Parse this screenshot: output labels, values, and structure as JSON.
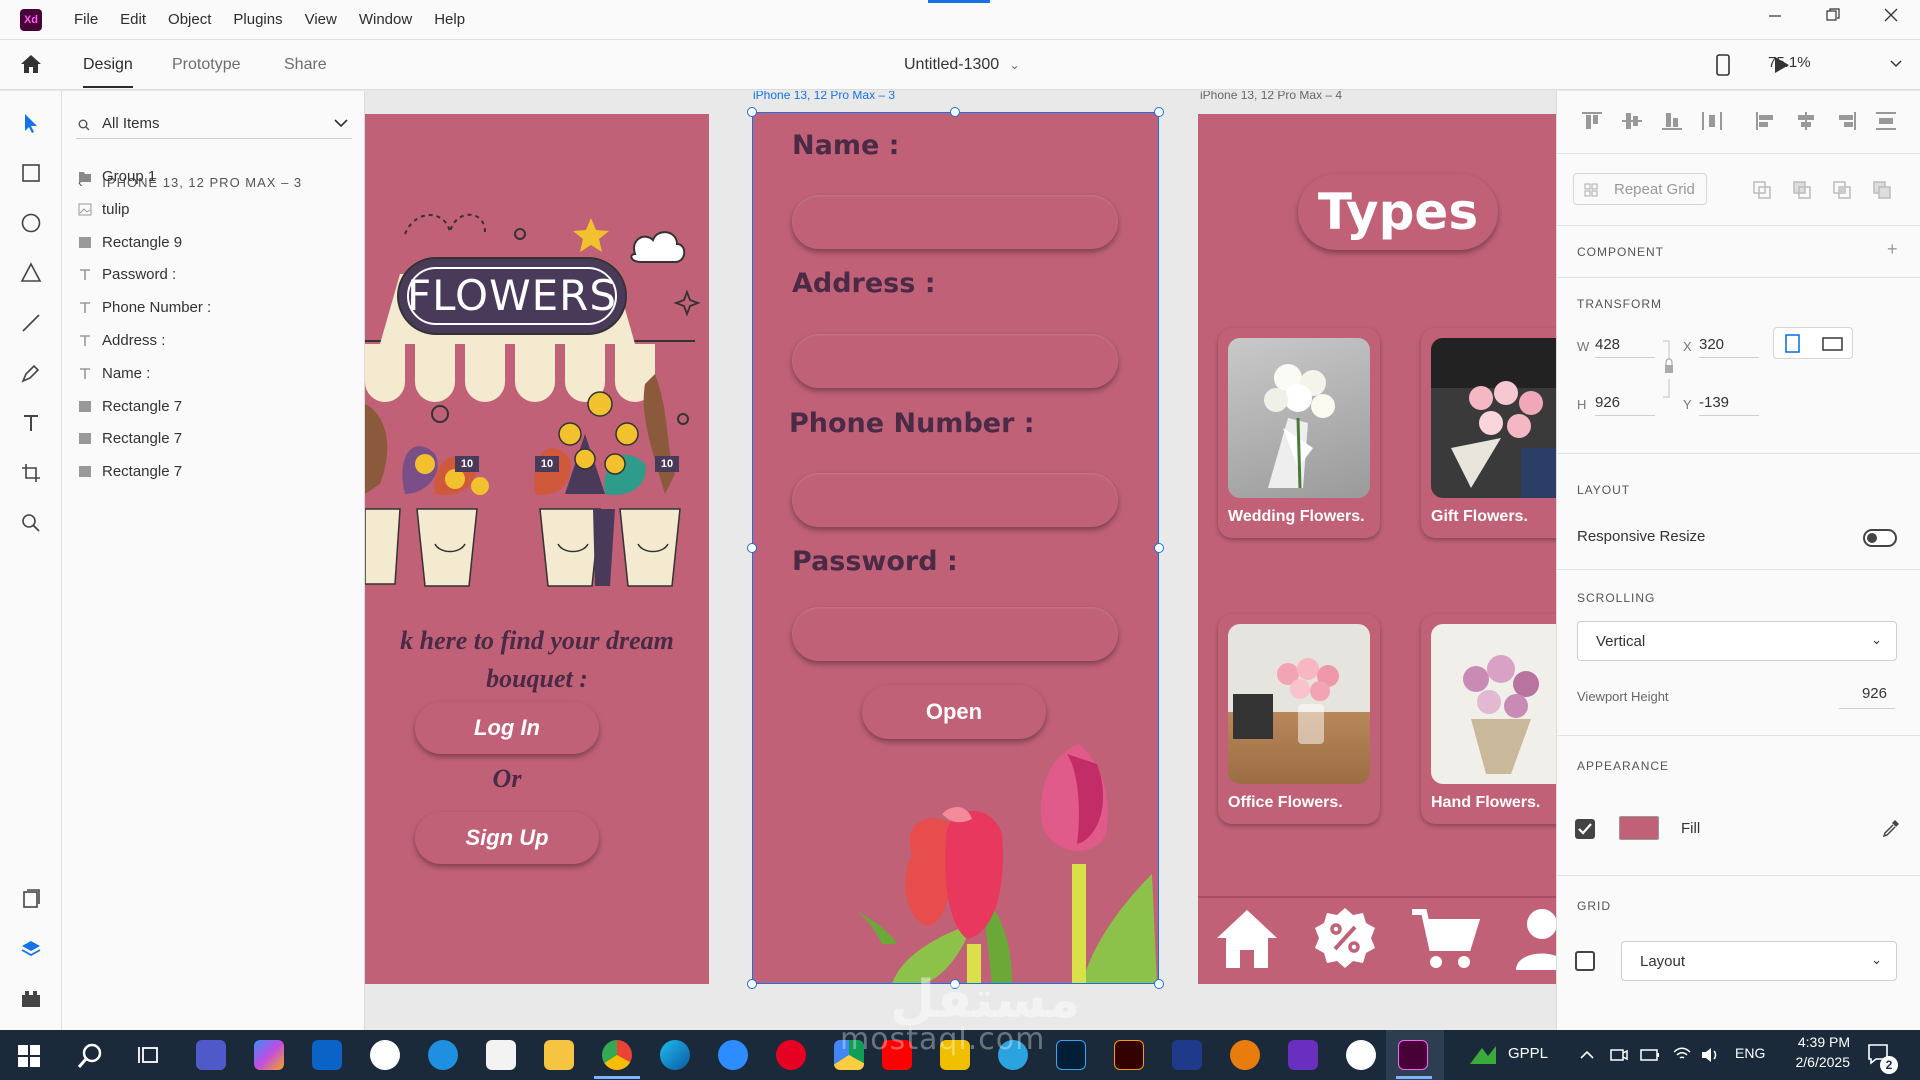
{
  "app": {
    "logo": "Xd",
    "menu": [
      "File",
      "Edit",
      "Object",
      "Plugins",
      "View",
      "Window",
      "Help"
    ],
    "tabs": [
      "Design",
      "Prototype",
      "Share"
    ],
    "document_title": "Untitled-1300",
    "zoom": "75.1%"
  },
  "layers": {
    "search_label": "All Items",
    "breadcrumb": "IPHONE 13, 12 PRO MAX – 3",
    "items": [
      {
        "name": "Group 1",
        "icon": "folder-icon"
      },
      {
        "name": "tulip",
        "icon": "image-icon"
      },
      {
        "name": "Rectangle 9",
        "icon": "rectangle-icon"
      },
      {
        "name": "Password :",
        "icon": "text-icon"
      },
      {
        "name": "Phone Number :",
        "icon": "text-icon"
      },
      {
        "name": "Address :",
        "icon": "text-icon"
      },
      {
        "name": "Name :",
        "icon": "text-icon"
      },
      {
        "name": "Rectangle 7",
        "icon": "rectangle-icon"
      },
      {
        "name": "Rectangle 7",
        "icon": "rectangle-icon"
      },
      {
        "name": "Rectangle 7",
        "icon": "rectangle-icon"
      }
    ]
  },
  "artboards": {
    "left": {
      "sign_text": "FLOWERS",
      "tag_numbers": [
        "10",
        "10",
        "10"
      ],
      "tagline": "k here to find your dream bouquet :",
      "login_button": "Log In",
      "or_text": "Or",
      "signup_button": "Sign Up"
    },
    "middle": {
      "label": "iPhone 13, 12 Pro Max – 3",
      "fields": [
        "Name :",
        "Address :",
        "Phone Number :",
        "Password :"
      ],
      "open_button": "Open"
    },
    "right": {
      "label": "iPhone 13, 12 Pro Max – 4",
      "title": "Types",
      "cards": [
        "Wedding Flowers.",
        "Gift Flowers.",
        "Office Flowers.",
        "Hand Flowers."
      ],
      "nav_icons": [
        "home-icon",
        "discount-icon",
        "cart-icon",
        "profile-icon"
      ]
    }
  },
  "inspector": {
    "repeat_grid": "Repeat Grid",
    "component_title": "COMPONENT",
    "transform_title": "TRANSFORM",
    "w_label": "W",
    "w_value": "428",
    "h_label": "H",
    "h_value": "926",
    "x_label": "X",
    "x_value": "320",
    "y_label": "Y",
    "y_value": "-139",
    "layout_title": "LAYOUT",
    "responsive_resize": "Responsive Resize",
    "scrolling_title": "SCROLLING",
    "scrolling_value": "Vertical",
    "viewport_label": "Viewport Height",
    "viewport_value": "926",
    "appearance_title": "APPEARANCE",
    "fill_label": "Fill",
    "fill_color": "#c06178",
    "fill_checked": true,
    "grid_title": "GRID",
    "grid_value": "Layout",
    "grid_checked": false
  },
  "taskbar": {
    "app_label": "GPPL",
    "lang": "ENG",
    "time": "4:39 PM",
    "date": "2/6/2025",
    "notification_count": "2"
  },
  "watermark": {
    "arabic": "مستقل",
    "latin": "mostaql.com"
  },
  "colors": {
    "artboard": "#c06178",
    "accent": "#1473e6",
    "label_dark": "#4b2a45",
    "taskbar": "#1b2a3a"
  }
}
